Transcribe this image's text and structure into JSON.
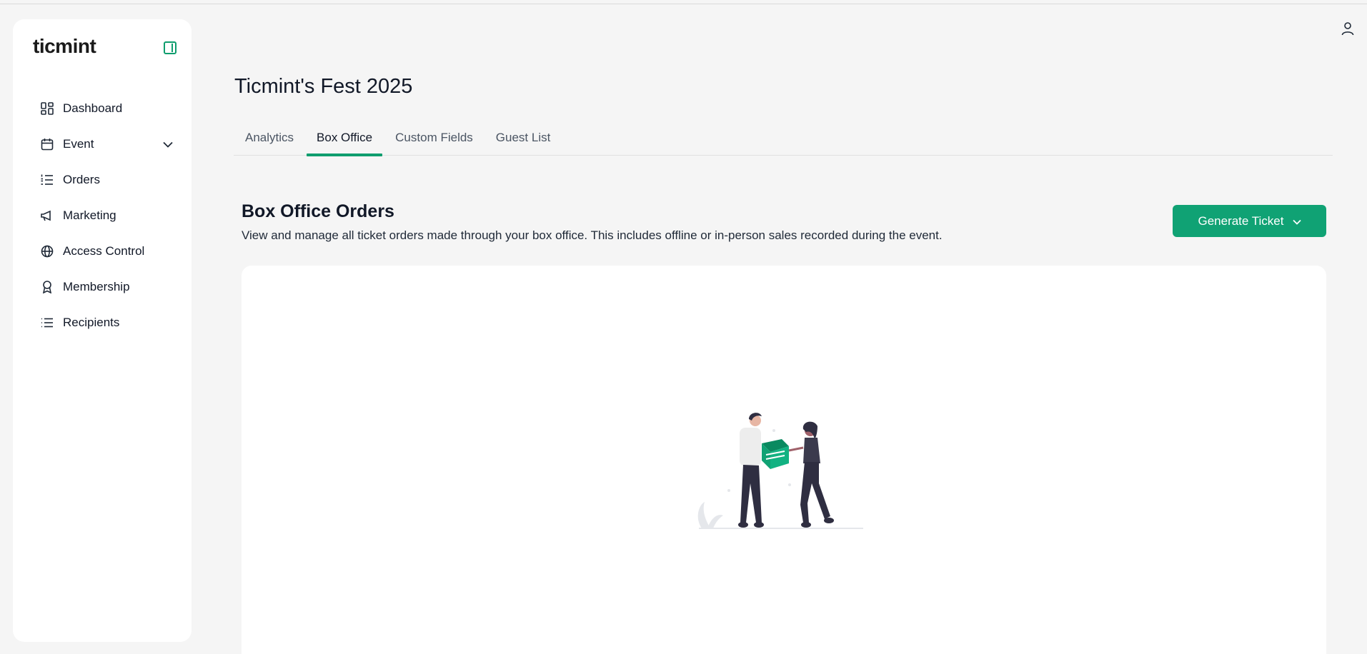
{
  "app": {
    "logo": "ticmint"
  },
  "sidebar": {
    "items": [
      {
        "label": "Dashboard",
        "icon": "dashboard-icon"
      },
      {
        "label": "Event",
        "icon": "calendar-icon",
        "expandable": true
      },
      {
        "label": "Orders",
        "icon": "list-ordered-icon"
      },
      {
        "label": "Marketing",
        "icon": "megaphone-icon"
      },
      {
        "label": "Access Control",
        "icon": "globe-icon"
      },
      {
        "label": "Membership",
        "icon": "award-icon"
      },
      {
        "label": "Recipients",
        "icon": "list-icon"
      }
    ]
  },
  "header": {
    "title": "Ticmint's Fest 2025"
  },
  "tabs": [
    {
      "label": "Analytics",
      "active": false
    },
    {
      "label": "Box Office",
      "active": true
    },
    {
      "label": "Custom Fields",
      "active": false
    },
    {
      "label": "Guest List",
      "active": false
    }
  ],
  "section": {
    "title": "Box Office Orders",
    "description": "View and manage all ticket orders made through your box office. This includes offline or in-person sales recorded during the event.",
    "action_label": "Generate Ticket"
  },
  "colors": {
    "accent": "#10a274",
    "background": "#f5f5f5",
    "card": "#ffffff"
  }
}
